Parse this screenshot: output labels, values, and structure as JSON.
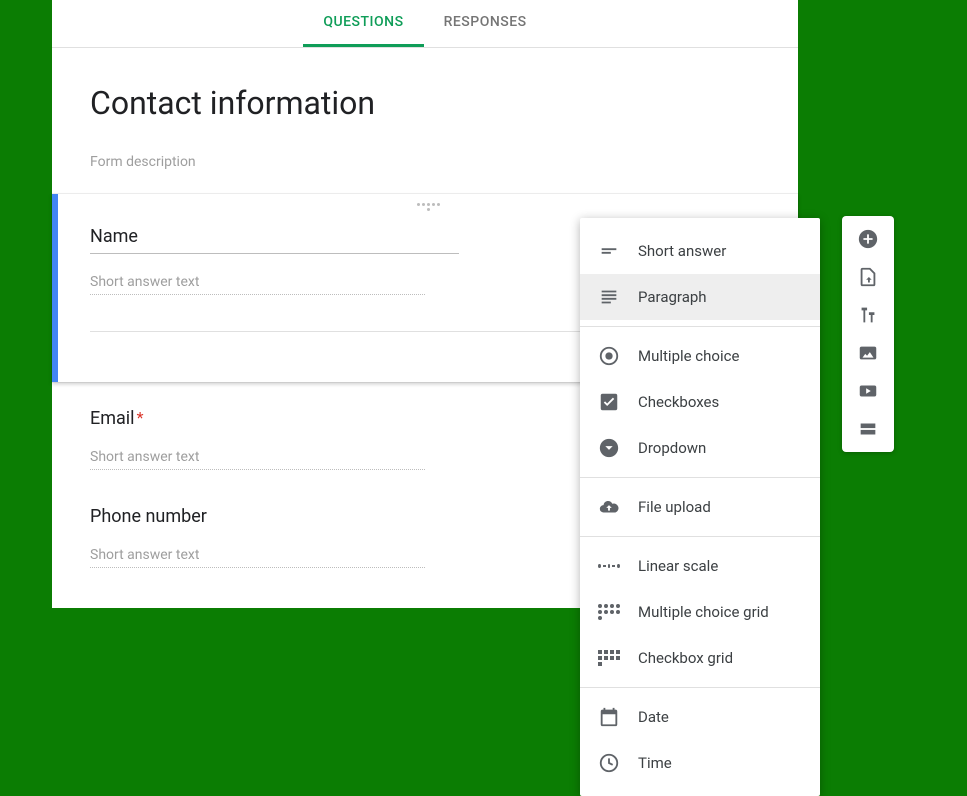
{
  "tabs": {
    "questions": "QUESTIONS",
    "responses": "RESPONSES"
  },
  "form": {
    "title": "Contact information",
    "description": "Form description"
  },
  "active_question": {
    "title": "Name",
    "answer_placeholder": "Short answer text"
  },
  "questions": [
    {
      "title": "Email",
      "required": true,
      "answer_placeholder": "Short answer text"
    },
    {
      "title": "Phone number",
      "required": false,
      "answer_placeholder": "Short answer text"
    }
  ],
  "type_menu": {
    "short_answer": "Short answer",
    "paragraph": "Paragraph",
    "multiple_choice": "Multiple choice",
    "checkboxes": "Checkboxes",
    "dropdown": "Dropdown",
    "file_upload": "File upload",
    "linear_scale": "Linear scale",
    "mc_grid": "Multiple choice grid",
    "cb_grid": "Checkbox grid",
    "date": "Date",
    "time": "Time",
    "selected": "paragraph"
  },
  "side_toolbar": {
    "add_question": "Add question",
    "import_questions": "Import questions",
    "add_title": "Add title and description",
    "add_image": "Add image",
    "add_video": "Add video",
    "add_section": "Add section"
  }
}
